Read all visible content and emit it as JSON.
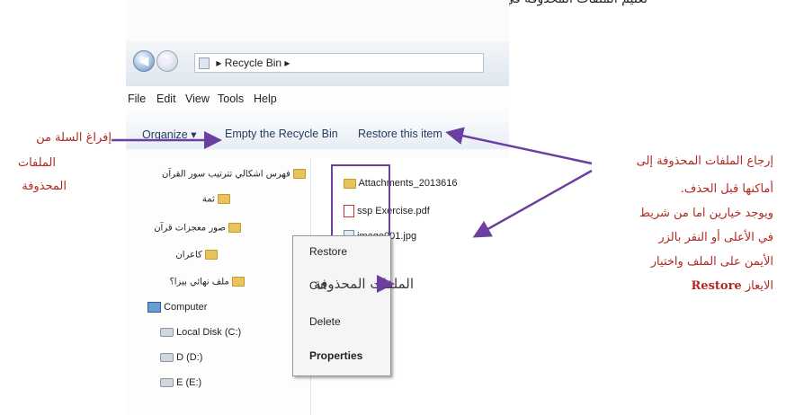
{
  "top_caption": "تعليم الملفات المحذوفة في سلة المحذوفات",
  "address_bar": {
    "location": "Recycle Bin",
    "back_icon": "back-arrow-icon",
    "forward_icon": "forward-arrow-icon"
  },
  "menu": {
    "file": "File",
    "edit": "Edit",
    "view": "View",
    "tools": "Tools",
    "help": "Help"
  },
  "toolbar": {
    "organize": "Organize",
    "empty": "Empty the Recycle Bin",
    "restore": "Restore this item"
  },
  "nav_pane": {
    "folders": [
      "فهرس اشكالي تترتيب سور القرآن",
      "ثمة",
      "صور معجزات قرآن",
      "كاعران",
      "ملف نهائي بيزا؟"
    ],
    "computer": "Computer",
    "drives": [
      "Local Disk (C:)",
      "D (D:)",
      "E (E:)"
    ]
  },
  "files": [
    {
      "name": "Attachments_2013616",
      "icon": "folder-icon"
    },
    {
      "name": "ssp Exercise.pdf",
      "icon": "pdf-icon"
    },
    {
      "name": "image001.jpg",
      "icon": "image-icon"
    }
  ],
  "context_menu": {
    "restore": "Restore",
    "cut": "Cut",
    "delete": "Delete",
    "properties": "Properties"
  },
  "annotations": {
    "empty_line1": "إفراغ السلة من",
    "empty_line2": "الملفات",
    "empty_line3": "المحذوفة",
    "deleted_files": "الملفات المحذوفة",
    "restore_line1": "إرجاع الملفات المحذوفة إلى",
    "restore_line2": "أماكنها قبل الحذف.",
    "restore_line3": "ويوجد خيارين اما من شريط",
    "restore_line4": "في الأعلى أو النقر بالزر",
    "restore_line5": "الأيمن على الملف واختيار",
    "restore_line6_prefix": "الايعاز",
    "restore_line6_cmd": "Restore"
  },
  "colors": {
    "annotation_red": "#b02a22",
    "highlight_purple": "#6a3fa0"
  }
}
